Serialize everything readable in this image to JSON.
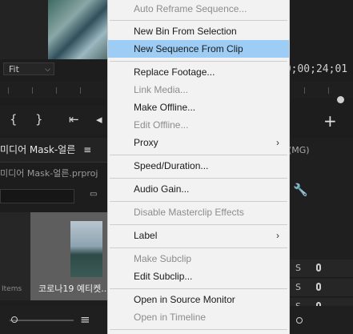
{
  "source_monitor": {
    "fit_label": "Fit",
    "timecode": "00;00;24;01"
  },
  "project_panel": {
    "tab_label": "미디어 Mask-얼른",
    "project_file": "미디어 Mask-얼른.prproj",
    "clip_name": "코로나19 예티켓...",
    "items_label": "Items"
  },
  "right_panel": {
    "tab_label": "(MG)",
    "solo_label": "S"
  },
  "context_menu": {
    "items": [
      {
        "label": "Auto Reframe Sequence...",
        "enabled": false
      },
      {
        "label": "New Bin From Selection",
        "enabled": true
      },
      {
        "label": "New Sequence From Clip",
        "enabled": true,
        "highlighted": true
      },
      {
        "label": "Replace Footage...",
        "enabled": true
      },
      {
        "label": "Link Media...",
        "enabled": false
      },
      {
        "label": "Make Offline...",
        "enabled": true
      },
      {
        "label": "Edit Offline...",
        "enabled": false
      },
      {
        "label": "Proxy",
        "enabled": true,
        "submenu": true
      },
      {
        "label": "Speed/Duration...",
        "enabled": true
      },
      {
        "label": "Audio Gain...",
        "enabled": true
      },
      {
        "label": "Disable Masterclip Effects",
        "enabled": false
      },
      {
        "label": "Label",
        "enabled": true,
        "submenu": true
      },
      {
        "label": "Make Subclip",
        "enabled": false
      },
      {
        "label": "Edit Subclip...",
        "enabled": true
      },
      {
        "label": "Open in Source Monitor",
        "enabled": true
      },
      {
        "label": "Open in Timeline",
        "enabled": false
      }
    ],
    "submenu_arrow": "›"
  },
  "colors": {
    "menu_bg": "#f2f2f2",
    "highlight": "#9dcdf5",
    "disabled_text": "#8c8c8c"
  }
}
